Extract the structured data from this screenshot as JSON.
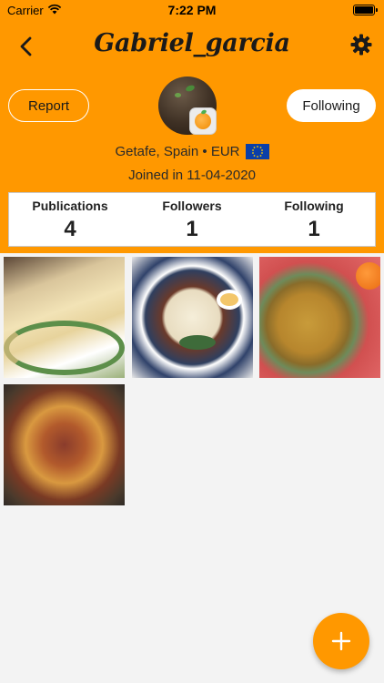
{
  "status_bar": {
    "carrier": "Carrier",
    "time": "7:22 PM"
  },
  "header": {
    "title": "Gabriel_garcia",
    "report_label": "Report",
    "following_label": "Following"
  },
  "profile": {
    "location": "Getafe, Spain • EUR",
    "joined": "Joined in 11-04-2020"
  },
  "stats": [
    {
      "label": "Publications",
      "value": "4"
    },
    {
      "label": "Followers",
      "value": "1"
    },
    {
      "label": "Following",
      "value": "1"
    }
  ],
  "colors": {
    "accent": "#FF9800",
    "background": "#F3F3F3"
  },
  "icons": {
    "back": "chevron-left-icon",
    "settings": "gear-icon",
    "add": "plus-icon",
    "currency_flag": "eu-flag-icon"
  }
}
